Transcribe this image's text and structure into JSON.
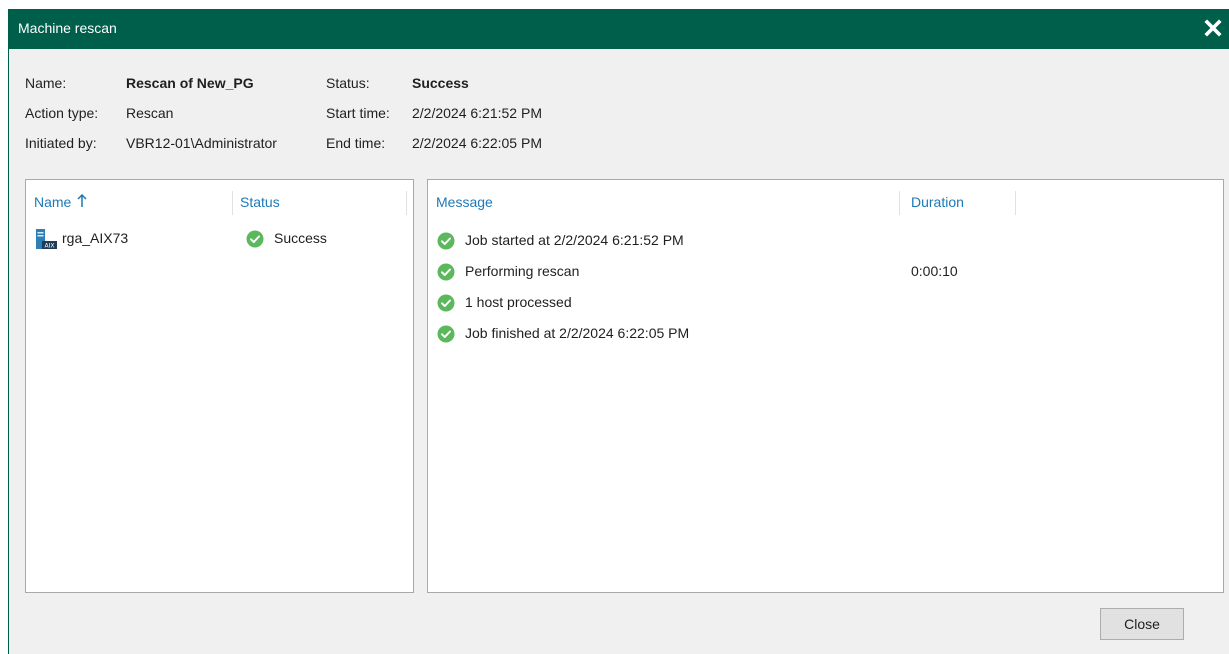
{
  "window": {
    "title": "Machine rescan",
    "close_icon": "close-icon"
  },
  "info": {
    "name_label": "Name:",
    "name_value": "Rescan of New_PG",
    "action_label": "Action type:",
    "action_value": "Rescan",
    "initiated_label": "Initiated by:",
    "initiated_value": "VBR12-01\\Administrator",
    "status_label": "Status:",
    "status_value": "Success",
    "start_label": "Start time:",
    "start_value": "2/2/2024 6:21:52 PM",
    "end_label": "End time:",
    "end_value": "2/2/2024 6:22:05 PM"
  },
  "objects": {
    "columns": {
      "name": "Name",
      "status": "Status"
    },
    "sort_icon": "sort-ascending-arrow-icon",
    "rows": [
      {
        "name": "rga_AIX73",
        "status": "Success",
        "icon": "aix-server-icon",
        "status_icon": "success-check-icon"
      }
    ]
  },
  "log": {
    "columns": {
      "message": "Message",
      "duration": "Duration"
    },
    "rows": [
      {
        "message": "Job started at 2/2/2024 6:21:52 PM",
        "duration": ""
      },
      {
        "message": "Performing rescan",
        "duration": "0:00:10"
      },
      {
        "message": "1 host processed",
        "duration": ""
      },
      {
        "message": "Job finished at 2/2/2024 6:22:05 PM",
        "duration": ""
      }
    ]
  },
  "buttons": {
    "close": "Close"
  },
  "colors": {
    "titlebar": "#005f4b",
    "success": "#5cb85c",
    "header_text": "#1c7ab8",
    "server_icon": "#2e7fb8"
  }
}
